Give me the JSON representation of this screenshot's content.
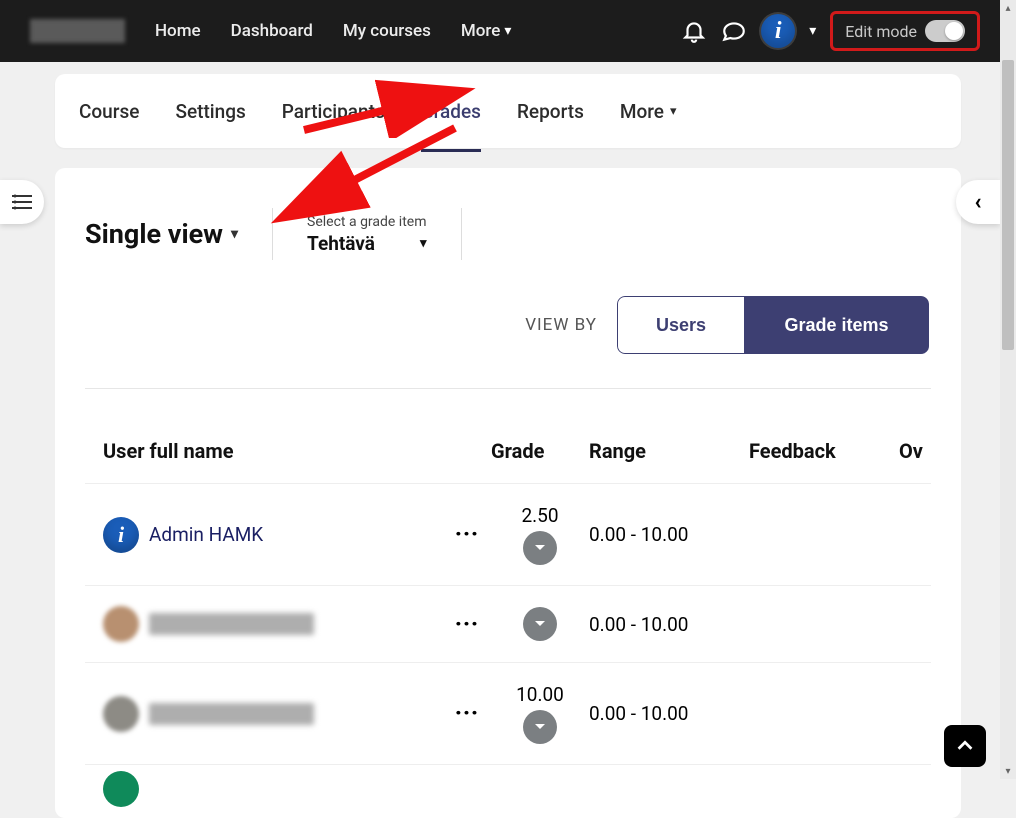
{
  "topnav": {
    "home": "Home",
    "dashboard": "Dashboard",
    "mycourses": "My courses",
    "more": "More"
  },
  "editmode": {
    "label": "Edit mode"
  },
  "secnav": {
    "course": "Course",
    "settings": "Settings",
    "participants": "Participants",
    "grades": "Grades",
    "reports": "Reports",
    "more": "More"
  },
  "selector": {
    "single_view": "Single view",
    "grade_item_label": "Select a grade item",
    "grade_item_value": "Tehtävä"
  },
  "viewby": {
    "label": "VIEW BY",
    "users": "Users",
    "grade_items": "Grade items"
  },
  "table": {
    "headers": {
      "user": "User full name",
      "grade": "Grade",
      "range": "Range",
      "feedback": "Feedback",
      "ov": "Ov"
    },
    "rows": [
      {
        "name": "Admin HAMK",
        "grade": "2.50",
        "range": "0.00 - 10.00",
        "blurred": false
      },
      {
        "name": "",
        "grade": "",
        "range": "0.00 - 10.00",
        "blurred": true
      },
      {
        "name": "",
        "grade": "10.00",
        "range": "0.00 - 10.00",
        "blurred": true
      }
    ]
  }
}
